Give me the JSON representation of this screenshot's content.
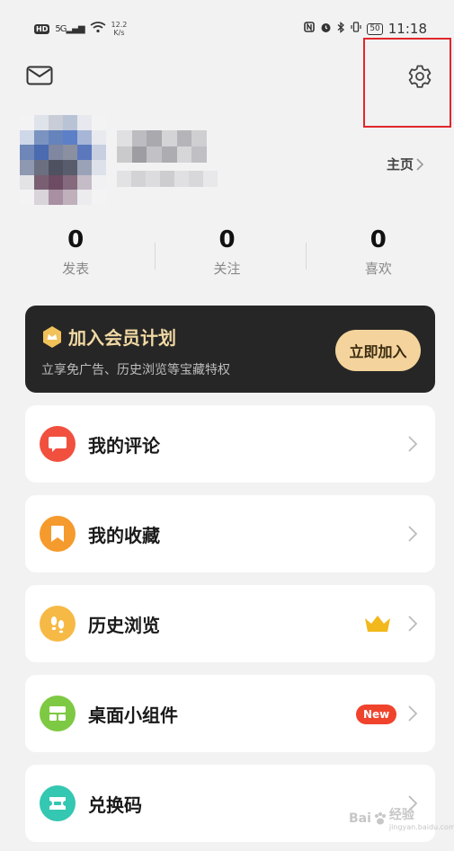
{
  "status_bar": {
    "left_badge": "HD",
    "signal": "5G",
    "net_speed_value": "12.2",
    "net_speed_unit": "K/s",
    "battery": "50",
    "time": "11:18"
  },
  "profile": {
    "homepage_link": "主页"
  },
  "stats": [
    {
      "value": "0",
      "label": "发表"
    },
    {
      "value": "0",
      "label": "关注"
    },
    {
      "value": "0",
      "label": "喜欢"
    }
  ],
  "membership": {
    "title": "加入会员计划",
    "subtitle": "立享免广告、历史浏览等宝藏特权",
    "button": "立即加入"
  },
  "menu": [
    {
      "label": "我的评论",
      "icon": "comment-icon",
      "color": "#f1503f"
    },
    {
      "label": "我的收藏",
      "icon": "bookmark-icon",
      "color": "#f59a2c"
    },
    {
      "label": "历史浏览",
      "icon": "footprint-icon",
      "color": "#f7b945",
      "extra": "crown-icon"
    },
    {
      "label": "桌面小组件",
      "icon": "widget-icon",
      "color": "#7dc943",
      "badge": "New"
    },
    {
      "label": "兑换码",
      "icon": "ticket-icon",
      "color": "#34c7b1"
    }
  ],
  "watermark": {
    "brand": "Bai",
    "suffix": "经验",
    "domain": "jingyan.baidu.com"
  },
  "colors": {
    "highlight": "#e0272b",
    "member_bg": "#262626",
    "member_gold": "#f4d49c"
  }
}
